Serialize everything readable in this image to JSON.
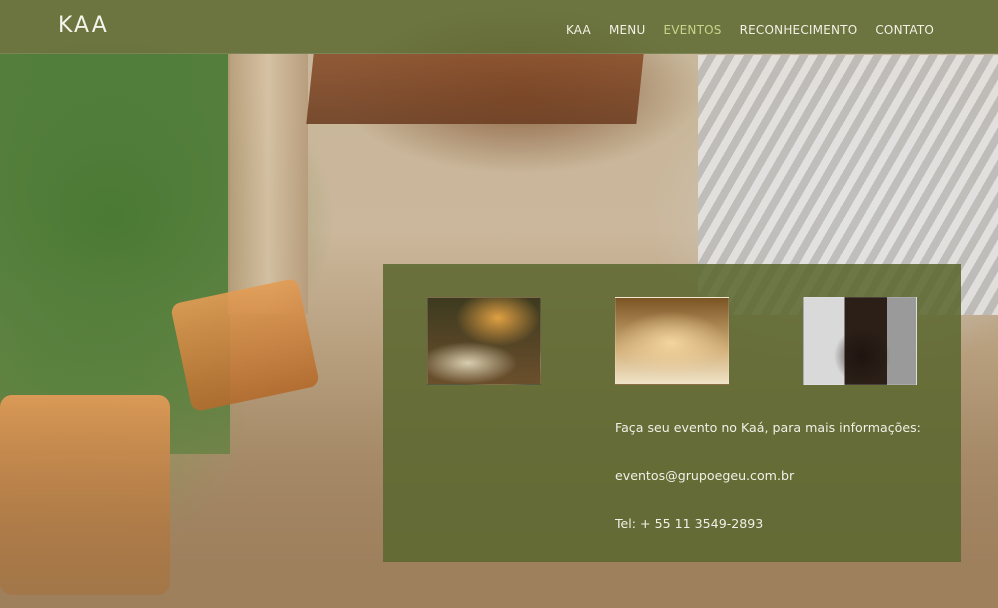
{
  "brand": {
    "logo_text": "KAA"
  },
  "nav": {
    "items": [
      {
        "label": "KAA",
        "active": false
      },
      {
        "label": "MENU",
        "active": false
      },
      {
        "label": "EVENTOS",
        "active": true
      },
      {
        "label": "RECONHECIMENTO",
        "active": false
      },
      {
        "label": "CONTATO",
        "active": false
      }
    ]
  },
  "events_panel": {
    "intro": "Faça seu evento no Kaá, para mais informações:",
    "email": "eventos@grupoegeu.com.br",
    "phone": "Tel: + 55 11 3549-2893"
  },
  "colors": {
    "header_bg": "#5C6830",
    "panel_bg": "#5C6830",
    "nav_text": "#F3F1E5",
    "nav_active": "#C9D58A"
  }
}
